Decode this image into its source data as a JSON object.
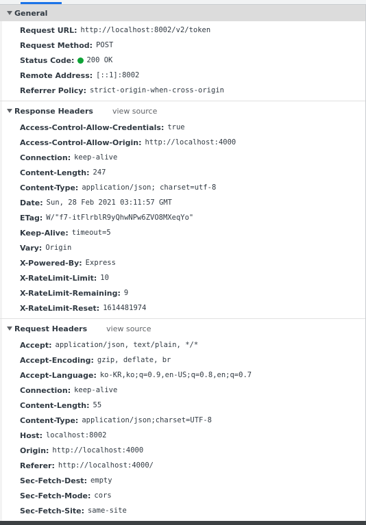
{
  "general": {
    "title": "General",
    "rows": [
      {
        "key": "Request URL:",
        "value": "http://localhost:8002/v2/token"
      },
      {
        "key": "Request Method:",
        "value": "POST"
      },
      {
        "key": "Status Code:",
        "value": "200 OK"
      },
      {
        "key": "Remote Address:",
        "value": "[::1]:8002"
      },
      {
        "key": "Referrer Policy:",
        "value": "strict-origin-when-cross-origin"
      }
    ],
    "status_color": "#0ea336"
  },
  "response_headers": {
    "title": "Response Headers",
    "view_source": "view source",
    "rows": [
      {
        "key": "Access-Control-Allow-Credentials:",
        "value": "true"
      },
      {
        "key": "Access-Control-Allow-Origin:",
        "value": "http://localhost:4000"
      },
      {
        "key": "Connection:",
        "value": "keep-alive"
      },
      {
        "key": "Content-Length:",
        "value": "247"
      },
      {
        "key": "Content-Type:",
        "value": "application/json; charset=utf-8"
      },
      {
        "key": "Date:",
        "value": "Sun, 28 Feb 2021 03:11:57 GMT"
      },
      {
        "key": "ETag:",
        "value": "W/\"f7-itFlrblR9yQhwNPw6ZVO8MXeqYo\""
      },
      {
        "key": "Keep-Alive:",
        "value": "timeout=5"
      },
      {
        "key": "Vary:",
        "value": "Origin"
      },
      {
        "key": "X-Powered-By:",
        "value": "Express"
      },
      {
        "key": "X-RateLimit-Limit:",
        "value": "10"
      },
      {
        "key": "X-RateLimit-Remaining:",
        "value": "9"
      },
      {
        "key": "X-RateLimit-Reset:",
        "value": "1614481974"
      }
    ]
  },
  "request_headers": {
    "title": "Request Headers",
    "view_source": "view source",
    "rows": [
      {
        "key": "Accept:",
        "value": "application/json, text/plain, */*"
      },
      {
        "key": "Accept-Encoding:",
        "value": "gzip, deflate, br"
      },
      {
        "key": "Accept-Language:",
        "value": "ko-KR,ko;q=0.9,en-US;q=0.8,en;q=0.7"
      },
      {
        "key": "Connection:",
        "value": "keep-alive"
      },
      {
        "key": "Content-Length:",
        "value": "55"
      },
      {
        "key": "Content-Type:",
        "value": "application/json;charset=UTF-8"
      },
      {
        "key": "Host:",
        "value": "localhost:8002"
      },
      {
        "key": "Origin:",
        "value": "http://localhost:4000"
      },
      {
        "key": "Referer:",
        "value": "http://localhost:4000/"
      },
      {
        "key": "Sec-Fetch-Dest:",
        "value": "empty"
      },
      {
        "key": "Sec-Fetch-Mode:",
        "value": "cors"
      },
      {
        "key": "Sec-Fetch-Site:",
        "value": "same-site"
      }
    ]
  }
}
